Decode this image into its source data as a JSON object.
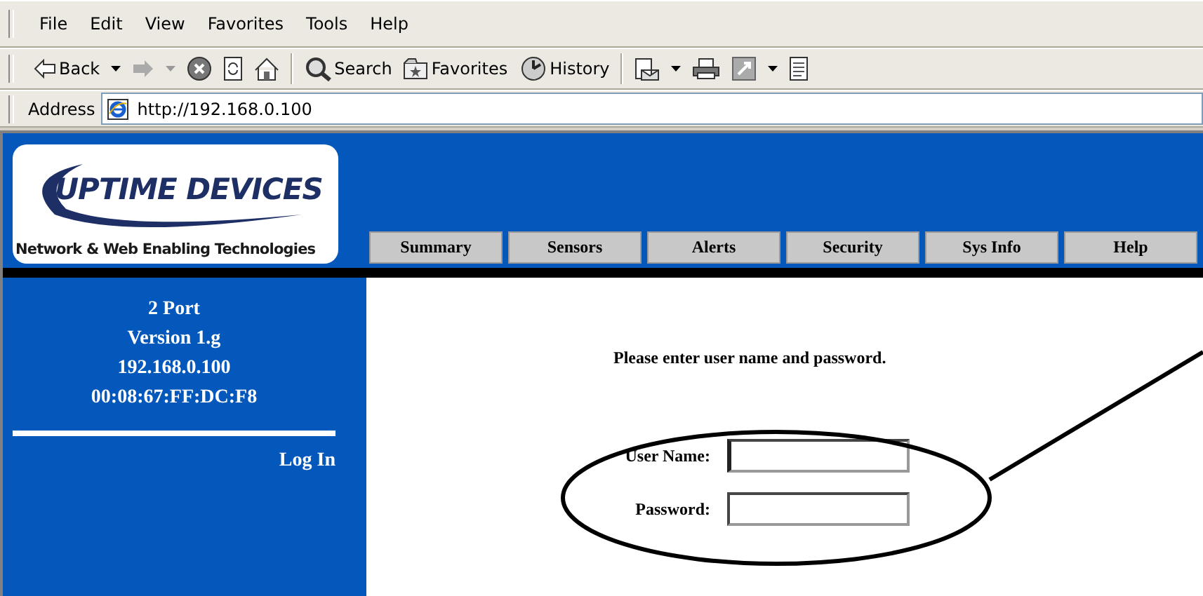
{
  "menu": [
    "File",
    "Edit",
    "View",
    "Favorites",
    "Tools",
    "Help"
  ],
  "toolbar": [
    {
      "kind": "back",
      "label": "Back",
      "dropdown": true
    },
    {
      "kind": "forward",
      "dropdown": true
    },
    {
      "kind": "stop"
    },
    {
      "kind": "refresh"
    },
    {
      "kind": "home"
    },
    {
      "kind": "separator"
    },
    {
      "kind": "search",
      "label": "Search"
    },
    {
      "kind": "favorites",
      "label": "Favorites"
    },
    {
      "kind": "history",
      "label": "History"
    },
    {
      "kind": "separator"
    },
    {
      "kind": "mail",
      "dropdown": true
    },
    {
      "kind": "print"
    },
    {
      "kind": "edit",
      "dropdown": true
    },
    {
      "kind": "discuss"
    }
  ],
  "address": {
    "label": "Address",
    "value": "http://192.168.0.100"
  },
  "logo": {
    "name": "UPTIME DEVICES",
    "tagline": "Network & Web Enabling Technologies"
  },
  "tabs": [
    "Summary",
    "Sensors",
    "Alerts",
    "Security",
    "Sys Info",
    "Help"
  ],
  "sidebar": {
    "info": [
      "2 Port",
      "Version 1.g",
      "192.168.0.100",
      "00:08:67:FF:DC:F8"
    ],
    "link": "Log In"
  },
  "login": {
    "prompt": "Please enter user name and password.",
    "fields": [
      {
        "label": "User Name:",
        "focused": true
      },
      {
        "label": "Password:",
        "focused": false
      }
    ]
  }
}
